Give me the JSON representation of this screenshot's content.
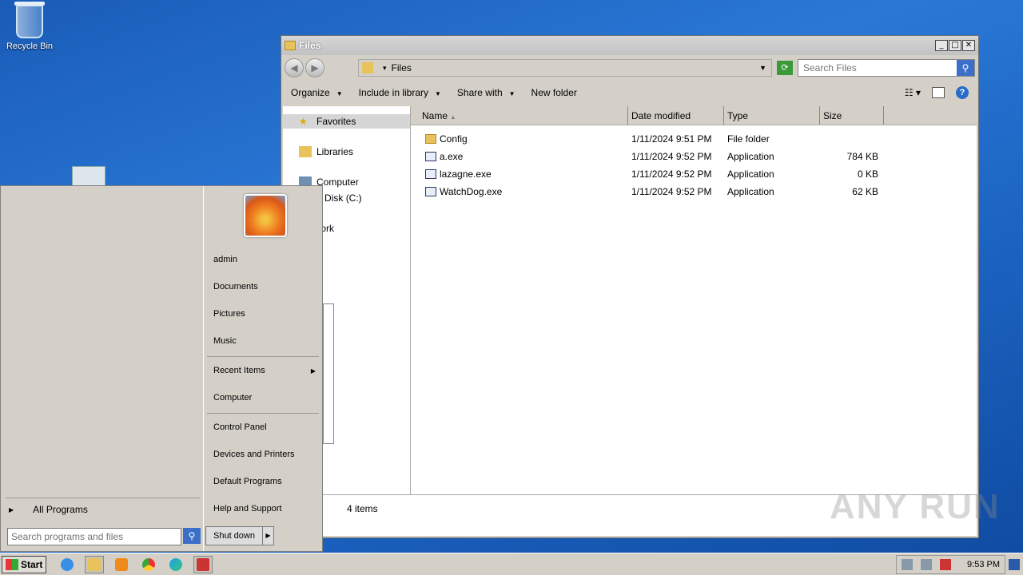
{
  "desktop": {
    "recycle_bin_label": "Recycle Bin"
  },
  "window": {
    "title": "Files",
    "breadcrumb": "Files",
    "search_placeholder": "Search Files",
    "toolbar": {
      "organize": "Organize",
      "include_in_library": "Include in library",
      "share_with": "Share with",
      "new_folder": "New folder"
    },
    "nav": {
      "favorites": "Favorites",
      "libraries": "Libraries",
      "computer": "Computer",
      "local_disk": "Local Disk (C:)",
      "network": "Network"
    },
    "columns": {
      "name": "Name",
      "date_modified": "Date modified",
      "type": "Type",
      "size": "Size"
    },
    "files": [
      {
        "name": "Config",
        "date": "1/11/2024 9:51 PM",
        "type": "File folder",
        "size": ""
      },
      {
        "name": "a.exe",
        "date": "1/11/2024 9:52 PM",
        "type": "Application",
        "size": "784 KB"
      },
      {
        "name": "lazagne.exe",
        "date": "1/11/2024 9:52 PM",
        "type": "Application",
        "size": "0 KB"
      },
      {
        "name": "WatchDog.exe",
        "date": "1/11/2024 9:52 PM",
        "type": "Application",
        "size": "62 KB"
      }
    ],
    "status": "4 items"
  },
  "start_menu": {
    "user": "admin",
    "items": {
      "documents": "Documents",
      "pictures": "Pictures",
      "music": "Music",
      "recent_items": "Recent Items",
      "computer": "Computer",
      "control_panel": "Control Panel",
      "devices_printers": "Devices and Printers",
      "default_programs": "Default Programs",
      "help_support": "Help and Support"
    },
    "all_programs": "All Programs",
    "search_placeholder": "Search programs and files",
    "shutdown": "Shut down"
  },
  "taskbar": {
    "start": "Start",
    "clock": "9:53 PM"
  },
  "watermark": "ANY RUN"
}
